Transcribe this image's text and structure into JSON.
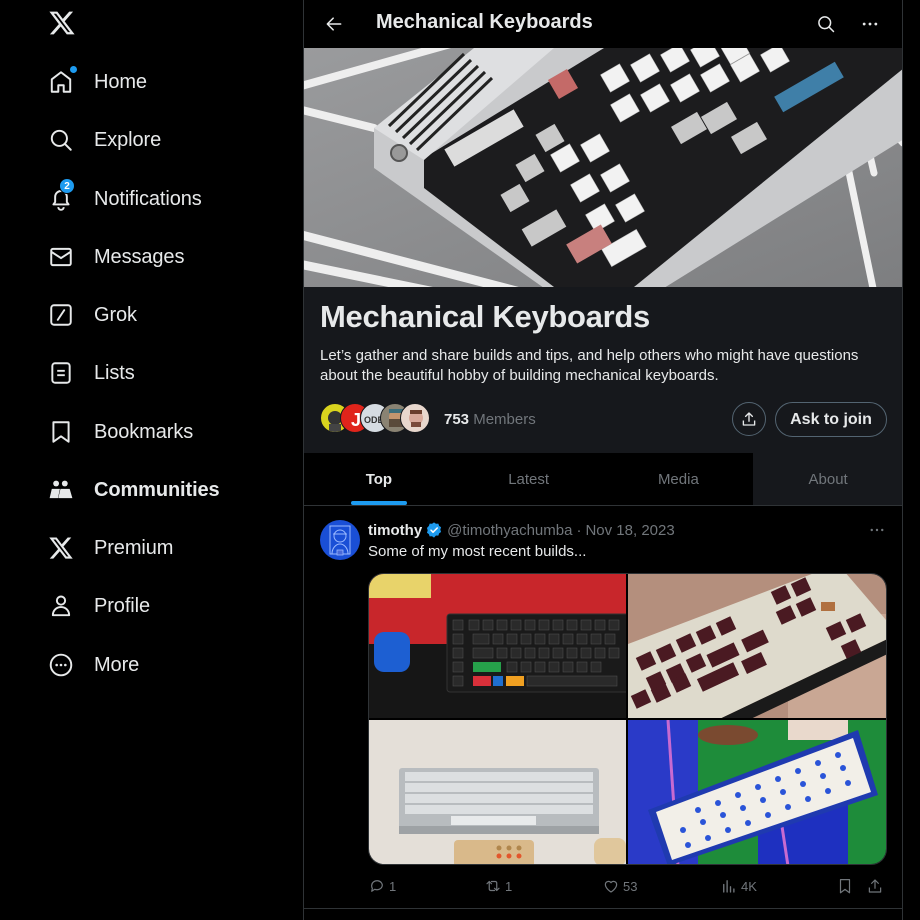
{
  "sidebar": {
    "logo": "x-logo",
    "items": [
      {
        "label": "Home",
        "icon": "home-icon",
        "has_dot": true
      },
      {
        "label": "Explore",
        "icon": "search-icon"
      },
      {
        "label": "Notifications",
        "icon": "bell-icon",
        "badge": "2"
      },
      {
        "label": "Messages",
        "icon": "envelope-icon"
      },
      {
        "label": "Grok",
        "icon": "grok-icon"
      },
      {
        "label": "Lists",
        "icon": "list-icon"
      },
      {
        "label": "Bookmarks",
        "icon": "bookmark-icon"
      },
      {
        "label": "Communities",
        "icon": "communities-icon",
        "active": true
      },
      {
        "label": "Premium",
        "icon": "x-premium-icon"
      },
      {
        "label": "Profile",
        "icon": "person-icon"
      },
      {
        "label": "More",
        "icon": "more-circle-icon"
      }
    ]
  },
  "header": {
    "title": "Mechanical Keyboards",
    "back_icon": "arrow-left-icon",
    "search_icon": "search-icon",
    "more_icon": "more-horizontal-icon"
  },
  "community": {
    "name": "Mechanical Keyboards",
    "description": "Let’s gather and share builds and tips, and help others who might have questions about the beautiful hobby of building mechanical keyboards.",
    "member_count": "753",
    "members_label": "Members",
    "join_label": "Ask to join",
    "share_icon": "share-icon"
  },
  "tabs": [
    {
      "label": "Top",
      "active": true
    },
    {
      "label": "Latest"
    },
    {
      "label": "Media"
    },
    {
      "label": "About"
    }
  ],
  "post": {
    "name": "timothy",
    "verified": true,
    "handle": "@timothyachumba",
    "separator": "·",
    "date": "Nov 18, 2023",
    "text": "Some of my most recent builds...",
    "image_count": 4,
    "stats": {
      "replies": "1",
      "reposts": "1",
      "likes": "53",
      "views": "4K"
    }
  },
  "colors": {
    "accent": "#1d9bf0",
    "background": "#000000",
    "panel": "#16181c",
    "text_primary": "#e7e9ea",
    "text_secondary": "#71767b",
    "border": "#2f3336"
  }
}
